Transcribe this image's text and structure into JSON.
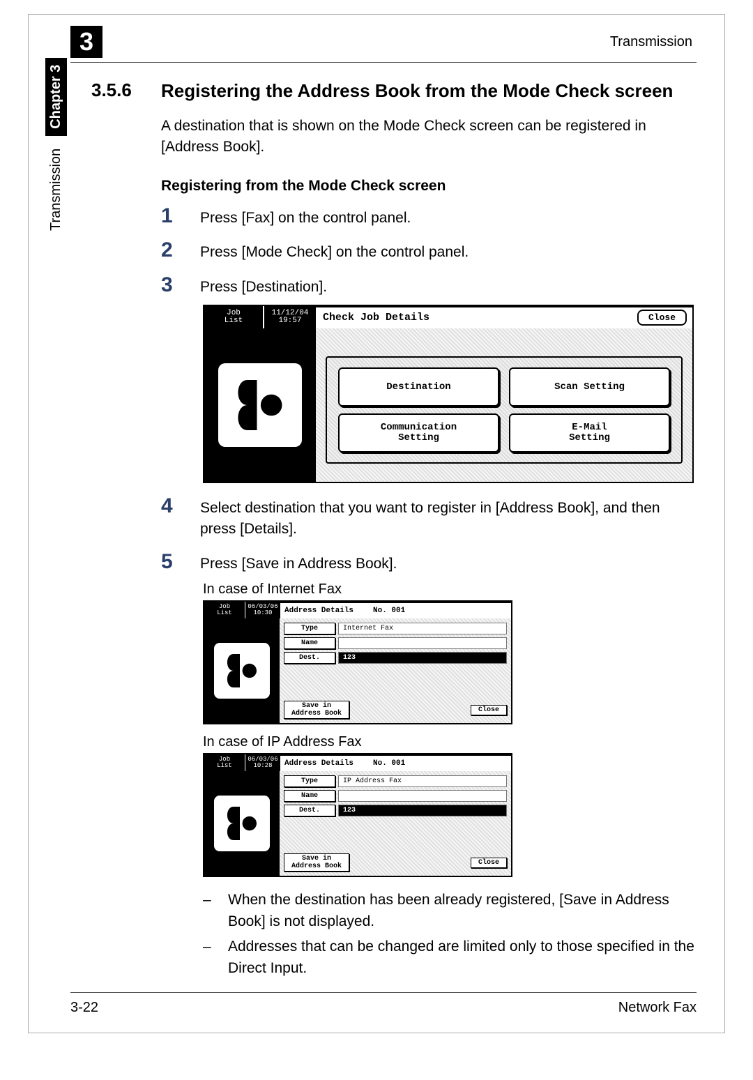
{
  "topbar": {
    "chapter_num": "3",
    "right_label": "Transmission"
  },
  "sidebar": {
    "transmission": "Transmission",
    "chapter": "Chapter 3"
  },
  "heading": {
    "number": "3.5.6",
    "title": "Registering the Address Book from the Mode Check screen"
  },
  "intro": "A destination that is shown on the Mode Check screen can be registered in [Address Book].",
  "subheading": "Registering from the Mode Check screen",
  "steps": {
    "s1": {
      "n": "1",
      "t": "Press [Fax] on the control panel."
    },
    "s2": {
      "n": "2",
      "t": "Press [Mode Check] on the control panel."
    },
    "s3": {
      "n": "3",
      "t": "Press [Destination]."
    },
    "s4": {
      "n": "4",
      "t": "Select destination that you want to register in [Address Book], and then press [Details]."
    },
    "s5": {
      "n": "5",
      "t": "Press [Save in Address Book]."
    }
  },
  "mock1": {
    "joblist_l1": "Job",
    "joblist_l2": "List",
    "date": "11/12/04",
    "time": "19:57",
    "title": "Check Job Details",
    "close": "Close",
    "btn_destination": "Destination",
    "btn_scan": "Scan Setting",
    "btn_comm_l1": "Communication",
    "btn_comm_l2": "Setting",
    "btn_email_l1": "E-Mail",
    "btn_email_l2": "Setting"
  },
  "caption_ifax": "In case of Internet Fax",
  "caption_ipfax": "In case of IP Address Fax",
  "mock2a": {
    "joblist_l1": "Job",
    "joblist_l2": "List",
    "date": "06/03/06",
    "time": "10:30",
    "title": "Address Details",
    "no": "No. 001",
    "lbl_type": "Type",
    "val_type": "Internet Fax",
    "lbl_name": "Name",
    "val_name": "",
    "lbl_dest": "Dest.",
    "val_dest": "123",
    "save_l1": "Save in",
    "save_l2": "Address Book",
    "close": "Close"
  },
  "mock2b": {
    "joblist_l1": "Job",
    "joblist_l2": "List",
    "date": "06/03/06",
    "time": "10:28",
    "title": "Address Details",
    "no": "No. 001",
    "lbl_type": "Type",
    "val_type": "IP Address Fax",
    "lbl_name": "Name",
    "val_name": "",
    "lbl_dest": "Dest.",
    "val_dest": "123",
    "save_l1": "Save in",
    "save_l2": "Address Book",
    "close": "Close"
  },
  "bullets": {
    "b1": "When the destination has been already registered, [Save in Address Book] is not displayed.",
    "b2": "Addresses that can be changed are limited only to those specified in the Direct Input."
  },
  "footer": {
    "left": "3-22",
    "right": "Network Fax"
  }
}
